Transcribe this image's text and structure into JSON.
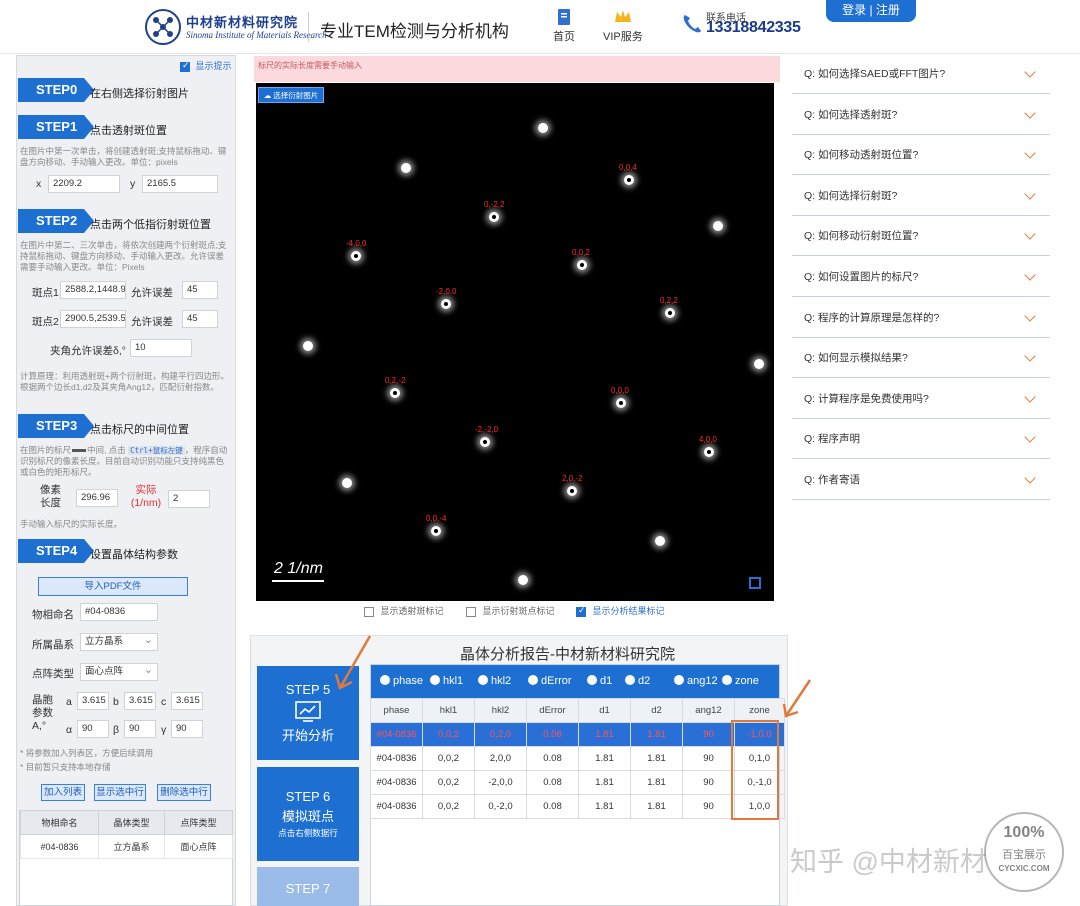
{
  "header": {
    "logo_cn": "中材新材料研究院",
    "logo_en": "Sinoma Institute of Materials Research",
    "slogan": "专业TEM检测与分析机构",
    "nav_home": "首页",
    "nav_vip": "VIP服务",
    "phone_label": "联系电话",
    "phone_number": "13318842335",
    "login": "登录",
    "register": "注册"
  },
  "left": {
    "show_hint": "显示提示",
    "step0": {
      "tag": "STEP0",
      "title": "在右侧选择衍射图片"
    },
    "step1": {
      "tag": "STEP1",
      "title": "点击透射斑位置",
      "note": "在图片中第一次单击，将创建透射斑;支持鼠标拖动、键盘方向移动、手动输入更改。单位：pixels",
      "x_label": "x",
      "x_value": "2209.2",
      "y_label": "y",
      "y_value": "2165.5"
    },
    "step2": {
      "tag": "STEP2",
      "title": "点击两个低指衍射斑位置",
      "note": "在图片中第二、三次单击，将依次创建两个衍射斑点;支持鼠标拖动、键盘方向移动、手动输入更改。允许误差需要手动输入更改。单位：Pixels",
      "spot1_label": "斑点1",
      "spot1_value": "2588.2,1448.9",
      "spot2_label": "斑点2",
      "spot2_value": "2900.5,2539.5",
      "tol_label": "允许误差",
      "tol1": "45",
      "tol2": "45",
      "angle_label": "夹角允许误差δ,°",
      "angle_value": "10",
      "calc_note": "计算原理：利用透射斑+两个衍射斑，构建平行四边形。根据两个边长d1,d2及其夹角Ang12，匹配衍射指数。"
    },
    "step3": {
      "tag": "STEP3",
      "title": "点击标尺的中间位置",
      "note_a": "在图片的标尺",
      "note_b": "中间, 点击",
      "note_key": "Ctrl+鼠标左键",
      "note_c": "，程序自动识别标尺的像素长度。目前自动识别功能只支持纯黑色或白色的矩形标尺。",
      "pixel_label": "像素长度",
      "pixel_value": "296.96",
      "real_label": "实际(1/nm)",
      "real_value": "2",
      "manual_note": "手动输入标尺的实际长度。"
    },
    "step4": {
      "tag": "STEP4",
      "title": "设置晶体结构参数",
      "import_pdf": "导入PDF文件",
      "name_label": "物相命名",
      "name_value": "#04-0836",
      "system_label": "所属晶系",
      "system_value": "立方晶系",
      "lattice_label": "点阵类型",
      "lattice_value": "面心点阵",
      "cell_label": "晶胞参数A,°",
      "a_label": "a",
      "a_value": "3.615",
      "b_label": "b",
      "b_value": "3.615",
      "c_label": "c",
      "c_value": "3.615",
      "alpha_label": "α",
      "alpha_value": "90",
      "beta_label": "β",
      "beta_value": "90",
      "gamma_label": "γ",
      "gamma_value": "90",
      "note1": "将参数加入列表区，方便后续调用",
      "note2": "目前暂只支持本地存储",
      "add_list": "加入列表",
      "show_selected": "显示选中行",
      "delete_selected": "删除选中行",
      "list_headers": [
        "物相命名",
        "晶体类型",
        "点阵类型"
      ],
      "list_rows": [
        [
          "#04-0836",
          "立方晶系",
          "面心点阵"
        ]
      ]
    }
  },
  "image": {
    "warning": "标尺的实际长度需要手动输入",
    "select_btn": "选择衍射图片",
    "scale_text": "2 1/nm",
    "spot_labels": [
      "0,0,4",
      "0,-2,2",
      "-4,0,0",
      "0,0,2",
      "-2,0,0",
      "0,2,2",
      "0,2,-2",
      "0,0,0",
      "-2,-2,0",
      "4,0,0",
      "2,0,-2",
      "0,0,-4"
    ],
    "opt_transmit": "显示透射斑标记",
    "opt_diffract": "显示衍射斑点标记",
    "opt_result": "显示分析结果标记"
  },
  "report": {
    "title": "晶体分析报告-中材新材料研究院",
    "step5_tag": "STEP 5",
    "step5_label": "开始分析",
    "step6_tag": "STEP 6",
    "step6_label": "模拟斑点",
    "step6_sub": "点击右侧数据行",
    "step7_tag": "STEP 7",
    "columns": [
      "phase",
      "hkl1",
      "hkl2",
      "dError",
      "d1",
      "d2",
      "ang12",
      "zone"
    ],
    "rows": [
      [
        "#04-0836",
        "0,0,2",
        "0,2,0",
        "0.08",
        "1.81",
        "1.81",
        "90",
        "-1,0,0"
      ],
      [
        "#04-0836",
        "0,0,2",
        "2,0,0",
        "0.08",
        "1.81",
        "1.81",
        "90",
        "0,1,0"
      ],
      [
        "#04-0836",
        "0,0,2",
        "-2,0,0",
        "0.08",
        "1.81",
        "1.81",
        "90",
        "0,-1,0"
      ],
      [
        "#04-0836",
        "0,0,2",
        "0,-2,0",
        "0.08",
        "1.81",
        "1.81",
        "90",
        "1,0,0"
      ]
    ]
  },
  "faq": [
    "Q: 如何选择SAED或FFT图片?",
    "Q: 如何选择透射斑?",
    "Q: 如何移动透射斑位置?",
    "Q: 如何选择衍射斑?",
    "Q: 如何移动衍射斑位置?",
    "Q: 如何设置图片的标尺?",
    "Q: 程序的计算原理是怎样的?",
    "Q: 如何显示模拟结果?",
    "Q: 计算程序是免费使用吗?",
    "Q: 程序声明",
    "Q: 作者寄语"
  ],
  "watermark": "知乎 @中材新材",
  "stamp": {
    "percent": "100%",
    "line1": "百宝展示",
    "line2": "CYCXIC.COM"
  },
  "colors": {
    "accent": "#1d6fd1",
    "highlight": "#e07a3c",
    "spot_label": "#ff2a2a"
  }
}
